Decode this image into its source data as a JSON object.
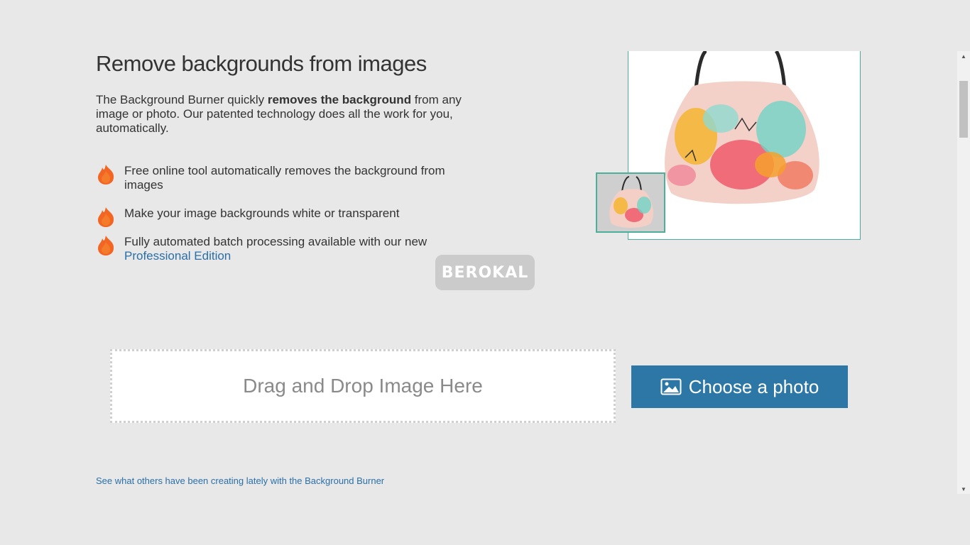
{
  "header": {
    "title": "Remove backgrounds from images"
  },
  "intro": {
    "part1": "The Background Burner quickly ",
    "bold": "removes the background",
    "part2": " from any image or photo. Our patented technology does all the work for you, automatically."
  },
  "features": [
    {
      "text": "Free online tool automatically removes the background from images"
    },
    {
      "text": "Make your image backgrounds white or transparent"
    },
    {
      "text": "Fully automated batch processing available with our new ",
      "link": "Professional Edition"
    }
  ],
  "watermark": "BEROKAL",
  "upload": {
    "dropzone_label": "Drag and Drop Image Here",
    "choose_label": "Choose a photo"
  },
  "footer": {
    "others_link": "See what others have been creating lately with the Background Burner"
  },
  "colors": {
    "accent": "#2c77a6",
    "frame": "#4caf9a",
    "flame": "#f26522"
  },
  "icons": [
    "flame-icon",
    "image-icon",
    "scroll-up-arrow",
    "scroll-down-arrow"
  ]
}
